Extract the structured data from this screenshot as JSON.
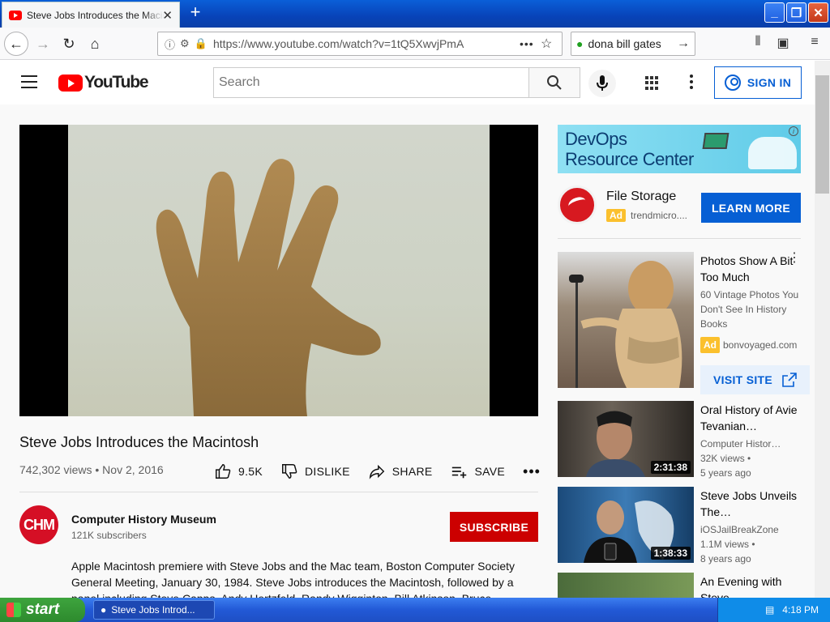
{
  "browser": {
    "tab_title": "Steve Jobs Introduces the Macintosh",
    "new_tab": "+",
    "url": "https://www.youtube.com/watch?v=1tQ5XwvjPmA",
    "search_query": "dona bill gates"
  },
  "youtube": {
    "logo_text": "YouTube",
    "search_placeholder": "Search",
    "sign_in": "SIGN IN",
    "video": {
      "title": "Steve Jobs Introduces the Macintosh",
      "meta": "742,302 views • Nov 2, 2016",
      "likes": "9.5K",
      "dislike": "DISLIKE",
      "share": "SHARE",
      "save": "SAVE"
    },
    "channel": {
      "avatar_text": "CHM",
      "name": "Computer History Museum",
      "subscribers": "121K subscribers",
      "subscribe": "SUBSCRIBE"
    },
    "description": "Apple Macintosh premiere with Steve Jobs and the Mac team, Boston Computer Society General Meeting, January 30, 1984. Steve Jobs introduces the Macintosh, followed by a panel including Steve Capps, Andy Hertzfeld, Randy Wigginton, Bill Atkinson, Bruce Horn"
  },
  "sidebar": {
    "banner_line1": "DevOps",
    "banner_line2": "Resource Center",
    "banner_info": "i",
    "promo": {
      "title": "File Storage",
      "ad_badge": "Ad",
      "advertiser": "trendmicro....",
      "button": "LEARN MORE"
    },
    "ad_card": {
      "title": "Photos Show A Bit Too Much",
      "subtitle": "60 Vintage Photos You Don't See In History Books",
      "ad_badge": "Ad",
      "domain": "bonvoyaged.com",
      "button": "VISIT SITE"
    },
    "recs": [
      {
        "title": "Oral History of Avie Tevanian…",
        "channel": "Computer Histor…",
        "views": "32K views •",
        "age": "5 years ago",
        "duration": "2:31:38"
      },
      {
        "title": "Steve Jobs Unveils The…",
        "channel": "iOSJailBreakZone",
        "views": "1.1M views •",
        "age": "8 years ago",
        "duration": "1:38:33"
      },
      {
        "title": "An Evening with Steve…"
      }
    ]
  },
  "taskbar": {
    "start": "start",
    "task": "Steve Jobs Introd...",
    "clock": "4:18 PM"
  }
}
